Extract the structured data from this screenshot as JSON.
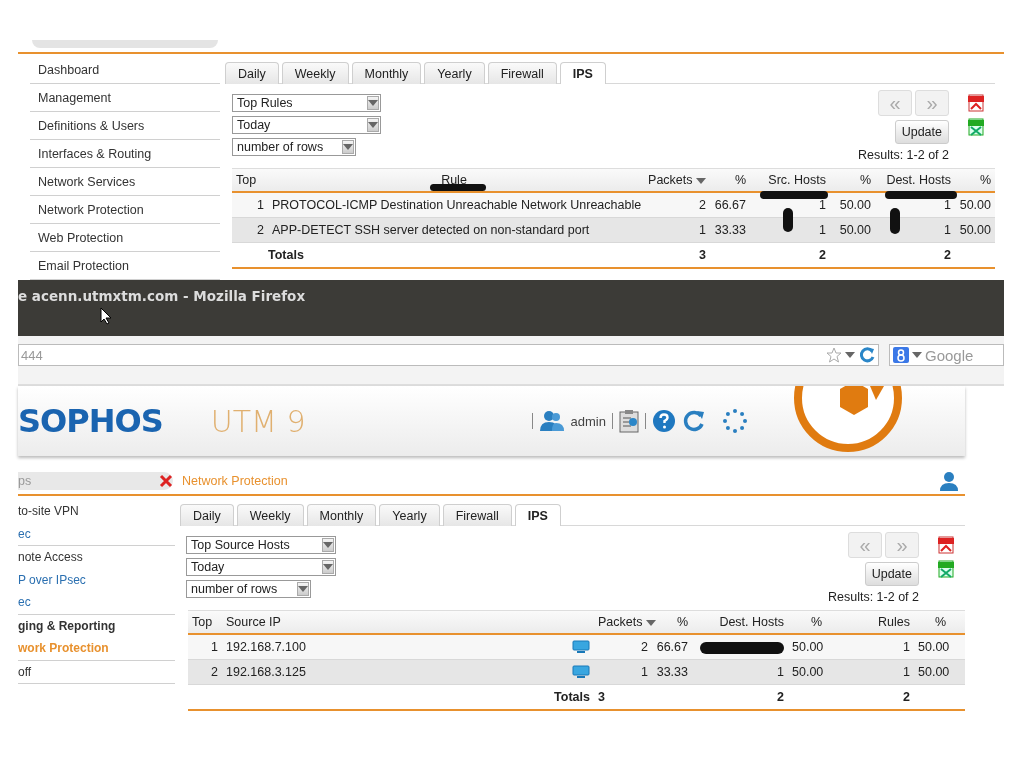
{
  "top_panel": {
    "sidebar": {
      "items": [
        {
          "label": "Dashboard"
        },
        {
          "label": "Management"
        },
        {
          "label": "Definitions & Users"
        },
        {
          "label": "Interfaces & Routing"
        },
        {
          "label": "Network Services"
        },
        {
          "label": "Network Protection"
        },
        {
          "label": "Web Protection"
        },
        {
          "label": "Email Protection"
        }
      ]
    },
    "tabs": [
      {
        "label": "Daily",
        "selected": false
      },
      {
        "label": "Weekly",
        "selected": false
      },
      {
        "label": "Monthly",
        "selected": false
      },
      {
        "label": "Yearly",
        "selected": false
      },
      {
        "label": "Firewall",
        "selected": false
      },
      {
        "label": "IPS",
        "selected": true
      }
    ],
    "selects": [
      {
        "value": "Top Rules"
      },
      {
        "value": "Today"
      },
      {
        "value": "number of rows"
      }
    ],
    "pager": {
      "prev": "«",
      "next": "»"
    },
    "update": "Update",
    "results": "Results: 1-2 of 2",
    "table": {
      "columns": [
        {
          "label": "Top"
        },
        {
          "label": "Rule"
        },
        {
          "label": "Packets",
          "sorted": true
        },
        {
          "label": "%"
        },
        {
          "label": "Src. Hosts"
        },
        {
          "label": "%"
        },
        {
          "label": "Dest. Hosts"
        },
        {
          "label": "%"
        }
      ],
      "rows": [
        {
          "cells": [
            "1",
            "PROTOCOL-ICMP Destination Unreachable Network Unreachable",
            "2",
            "66.67",
            "1",
            "50.00",
            "1",
            "50.00"
          ]
        },
        {
          "cells": [
            "2",
            "APP-DETECT SSH server detected on non-standard port",
            "1",
            "33.33",
            "1",
            "50.00",
            "1",
            "50.00"
          ]
        }
      ],
      "totals": {
        "label": "Totals",
        "values": [
          "3",
          "2",
          "2"
        ]
      }
    }
  },
  "browser": {
    "title": "e acenn.utmxtm.com - Mozilla Firefox",
    "url": "444",
    "search_placeholder": "Google"
  },
  "header": {
    "logo": "SOPHOS",
    "product": "UTM 9",
    "user": "admin"
  },
  "bottom_panel": {
    "search": "ps",
    "breadcrumb": "Network Protection",
    "sidebar": {
      "items": [
        {
          "label": "to-site VPN",
          "kind": "section"
        },
        {
          "label": "ec",
          "kind": "link",
          "selected": false
        },
        {
          "label": "note Access",
          "kind": "section"
        },
        {
          "label": "P over IPsec",
          "kind": "link",
          "selected": false
        },
        {
          "label": "ec",
          "kind": "link",
          "selected": false
        },
        {
          "label": "ging & Reporting",
          "kind": "section",
          "expanded": true
        },
        {
          "label": "work Protection",
          "kind": "link",
          "selected": true
        },
        {
          "label": "off",
          "kind": "section"
        }
      ]
    },
    "tabs": [
      {
        "label": "Daily",
        "selected": false
      },
      {
        "label": "Weekly",
        "selected": false
      },
      {
        "label": "Monthly",
        "selected": false
      },
      {
        "label": "Yearly",
        "selected": false
      },
      {
        "label": "Firewall",
        "selected": false
      },
      {
        "label": "IPS",
        "selected": true
      }
    ],
    "selects": [
      {
        "value": "Top Source Hosts"
      },
      {
        "value": "Today"
      },
      {
        "value": "number of rows"
      }
    ],
    "pager": {
      "prev": "«",
      "next": "»"
    },
    "update": "Update",
    "results": "Results: 1-2 of 2",
    "table": {
      "columns": [
        {
          "label": "Top"
        },
        {
          "label": "Source IP"
        },
        {
          "label": "Packets",
          "sorted": true
        },
        {
          "label": "%"
        },
        {
          "label": "Dest. Hosts"
        },
        {
          "label": "%"
        },
        {
          "label": "Rules"
        },
        {
          "label": "%"
        }
      ],
      "rows": [
        {
          "host_icon": true,
          "cells": [
            "1",
            "192.168.7.100",
            "2",
            "66.67",
            {
              "redacted": true
            },
            "50.00",
            "1",
            "50.00"
          ]
        },
        {
          "host_icon": true,
          "cells": [
            "2",
            "192.168.3.125",
            "1",
            "33.33",
            "1",
            "50.00",
            "1",
            "50.00"
          ]
        }
      ],
      "totals": {
        "label": "Totals",
        "values": [
          "3",
          "2",
          "2"
        ]
      }
    }
  }
}
